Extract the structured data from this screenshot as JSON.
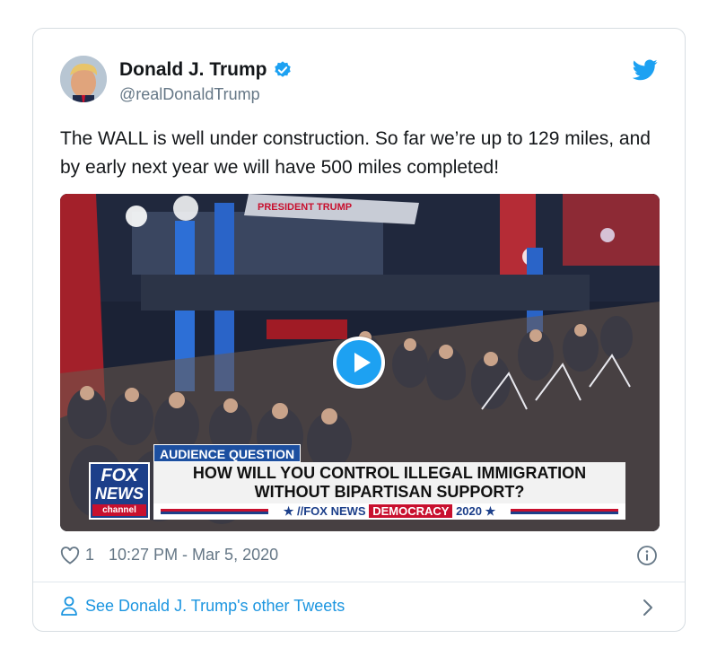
{
  "author": {
    "name": "Donald J. Trump",
    "handle": "@realDonaldTrump",
    "verified": true
  },
  "tweet": {
    "text": "The WALL is well under construction. So far we’re up to 129 miles, and by early next year we will have 500 miles completed!"
  },
  "video": {
    "backdrop_sign": "PRESIDENT TRUMP",
    "lower_third": {
      "tag": "AUDIENCE QUESTION",
      "question_line1": "HOW WILL YOU CONTROL ILLEGAL IMMIGRATION",
      "question_line2": "WITHOUT BIPARTISAN SUPPORT?",
      "logo_line1": "FOX",
      "logo_line2": "NEWS",
      "logo_line3": "channel",
      "brand_prefix": "★ //FOX NEWS",
      "brand_highlight": "DEMOCRACY",
      "brand_suffix": "2020 ★"
    }
  },
  "meta": {
    "like_count": "1",
    "timestamp": "10:27 PM - Mar 5, 2020"
  },
  "footer": {
    "link_text": "See Donald J. Trump's other Tweets"
  },
  "colors": {
    "accent": "#1da1f2",
    "link": "#1b95e0",
    "muted": "#657786",
    "fox_blue": "#1c3f8a",
    "fox_red": "#c8102e"
  },
  "icons": [
    "verified-badge-icon",
    "twitter-bird-icon",
    "play-icon",
    "heart-icon",
    "info-icon",
    "person-icon",
    "chevron-right-icon"
  ]
}
